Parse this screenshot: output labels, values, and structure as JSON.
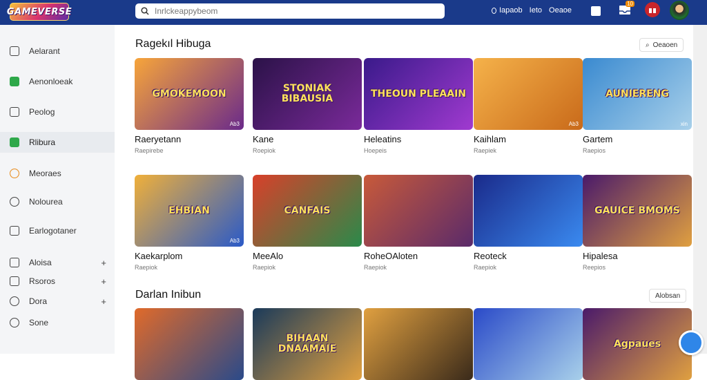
{
  "header": {
    "logo_text": "GAMEVERSE",
    "search_placeholder": "Inrlckeappybeom",
    "nav": [
      "Iapaob",
      "Ieto",
      "Oeaoe"
    ],
    "notif_badge": "10"
  },
  "sidebar": {
    "items": [
      {
        "label": "Aelarant",
        "icon": "box-icon"
      },
      {
        "label": "Aenonloeak",
        "icon": "chat-icon"
      },
      {
        "label": "Peolog",
        "icon": "box-icon"
      },
      {
        "label": "Rlibura",
        "icon": "check-icon",
        "active": true
      },
      {
        "label": "Meoraes",
        "icon": "coin-icon"
      },
      {
        "label": "Nolourea",
        "icon": "clock-icon"
      },
      {
        "label": "Earlogotaner",
        "icon": "lock-icon"
      },
      {
        "label": "Aloisa",
        "icon": "chart-icon",
        "plus": true
      },
      {
        "label": "Rsoros",
        "icon": "box-icon",
        "plus": true
      },
      {
        "label": "Dora",
        "icon": "user-icon",
        "plus": true
      },
      {
        "label": "Sone",
        "icon": "gear-icon"
      }
    ]
  },
  "sections": [
    {
      "title": "Ragekıl Hibuga",
      "see_all": "Oeaoen",
      "cards": [
        {
          "name": "Raeryetann",
          "sub": "Raepirebe",
          "banner": "GMOKEMOON",
          "tag": "Ab3",
          "bg1": "#f7a53a",
          "bg2": "#6a2a8a"
        },
        {
          "name": "Kane",
          "sub": "Roepiok",
          "banner": "STONIAK BIBAUSIA",
          "tag": "",
          "bg1": "#2b1248",
          "bg2": "#7a2a9a"
        },
        {
          "name": "Heleatins",
          "sub": "Hoepeis",
          "banner": "THEOUN PLEAAIN",
          "tag": "",
          "bg1": "#3a1a8a",
          "bg2": "#a03ad0"
        },
        {
          "name": "Kaihlam",
          "sub": "Raepiek",
          "banner": "",
          "tag": "Ab3",
          "bg1": "#f5b24a",
          "bg2": "#c96a1a"
        },
        {
          "name": "Gartem",
          "sub": "Raepios",
          "banner": "AUNIERENG",
          "tag": "xin",
          "bg1": "#3a8ad0",
          "bg2": "#a8d0ea"
        }
      ]
    },
    {
      "title": "",
      "see_all": "",
      "cards": [
        {
          "name": "Kaekarplom",
          "sub": "Raepiok",
          "banner": "EHBIAN",
          "tag": "Ab3",
          "bg1": "#f0b03a",
          "bg2": "#2a5ac8"
        },
        {
          "name": "MeeAlo",
          "sub": "Raepiok",
          "banner": "CANFAIS",
          "tag": "",
          "bg1": "#d8402a",
          "bg2": "#2a8a4a"
        },
        {
          "name": "RoheOAloten",
          "sub": "Raepiok",
          "banner": "",
          "tag": "",
          "bg1": "#c85a3a",
          "bg2": "#5a2a6a"
        },
        {
          "name": "Reoteck",
          "sub": "Raepiok",
          "banner": "",
          "tag": "",
          "bg1": "#1a2a8a",
          "bg2": "#3a8af0"
        },
        {
          "name": "Hipalesa",
          "sub": "Reepios",
          "banner": "GAUICE BMOMS",
          "tag": "",
          "bg1": "#4a1a6a",
          "bg2": "#e0a040"
        }
      ]
    },
    {
      "title": "Darlan Inibun",
      "see_all": "Alobsan",
      "cards": [
        {
          "name": "",
          "sub": "",
          "banner": "",
          "tag": "",
          "bg1": "#e06a2a",
          "bg2": "#2a4a8a"
        },
        {
          "name": "",
          "sub": "",
          "banner": "BIHAAN DNAAMAIE",
          "tag": "",
          "bg1": "#1a3a5a",
          "bg2": "#e0a040"
        },
        {
          "name": "",
          "sub": "",
          "banner": "",
          "tag": "",
          "bg1": "#e0a040",
          "bg2": "#3a2a1a"
        },
        {
          "name": "",
          "sub": "",
          "banner": "",
          "tag": "",
          "bg1": "#2a4ac8",
          "bg2": "#a8d0ea"
        },
        {
          "name": "",
          "sub": "",
          "banner": "Agpaues",
          "tag": "",
          "bg1": "#4a1a6a",
          "bg2": "#e0a040"
        }
      ]
    }
  ]
}
